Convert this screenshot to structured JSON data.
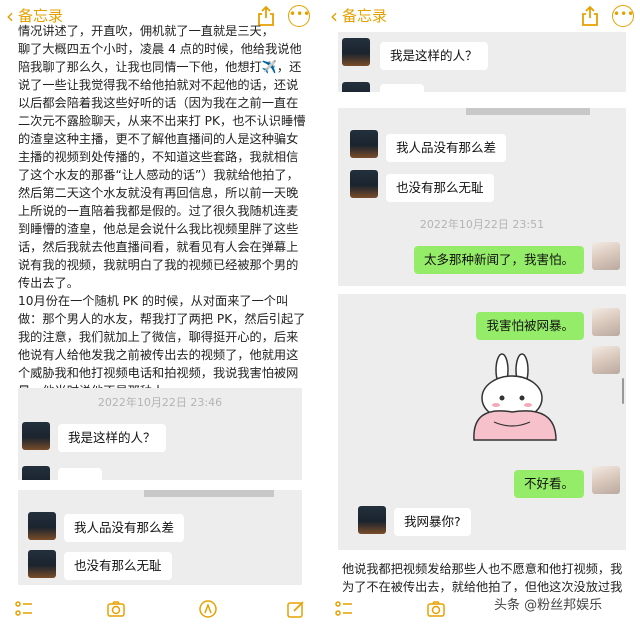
{
  "left": {
    "back_label": "备忘录",
    "story_lines": [
      "情况讲述了，开直吹，佣机就了一直就是三天，",
      "聊了大概四五个小时，凌晨 4 点的时候，他给我说他",
      "陪我聊了那么久，让我也同情一下他，他想打✈️，还",
      "说了一些让我觉得我不给他拍就对不起他的话，还说",
      "以后都会陪着我这些好听的话（因为我在之前一直在",
      "二次元不露脸聊天，从来不出来打 PK，也不认识睡懵",
      "的渣皇这种主播，更不了解他直播间的人是这种骗女",
      "主播的视频到处传播的，不知道这些套路，我就相信",
      "了这个水友的那番“让人感动的话”）我就给他拍了，",
      "然后第二天这个水友就没有再回信息，所以前一天晚",
      "上所说的一直陪着我都是假的。过了很久我随机连麦",
      "到睡懵的渣皇，他总是会说什么我比视频里胖了这些",
      "话，然后我就去他直播间看，就看见有人会在弹幕上",
      "说有我的视频，我就明白了我的视频已经被那个男的",
      "传出去了。",
      "    10月份在一个随机 PK 的时候，从对面来了一个叫",
      "做：那个男人的水友，帮我打了两把 PK，然后引起了",
      "我的注意，我们就加上了微信，聊得挺开心的，后来",
      "他说有人给他发我之前被传出去的视频了，他就用这",
      "个威胁我和他打视频电话和拍视频，我说我害怕被网",
      "暴，他当时说他不是那种人，"
    ],
    "chat_timestamp": "2022年10月22日 23:46",
    "msg_1": "我是这样的人？",
    "msg_2": "我人品没有那么差",
    "msg_3": "也没有那么无耻"
  },
  "right": {
    "back_label": "备忘录",
    "msg_1": "我是这样的人？",
    "msg_2": "我人品没有那么差",
    "msg_3": "也没有那么无耻",
    "timestamp": "2022年10月22日 23:51",
    "msg_4": "太多那种新闻了，我害怕。",
    "msg_5": "我害怕被网暴。",
    "msg_6": "不好看。",
    "msg_7": "我网暴你?",
    "story_line_1": "他说我都把视频发给那些人也不愿意和他打视频，我",
    "story_line_2": "为了不在被传出去，就给他拍了，但他这次没放过我"
  },
  "watermark": "头条 @粉丝邦娱乐",
  "colors": {
    "accent": "#e6a100",
    "chat_bg": "#ededed",
    "my_bubble": "#95ec69",
    "their_bubble": "#ffffff"
  },
  "icons": [
    "back-chevron-icon",
    "share-icon",
    "more-icon",
    "checklist-icon",
    "camera-icon",
    "markup-icon",
    "compose-icon"
  ]
}
